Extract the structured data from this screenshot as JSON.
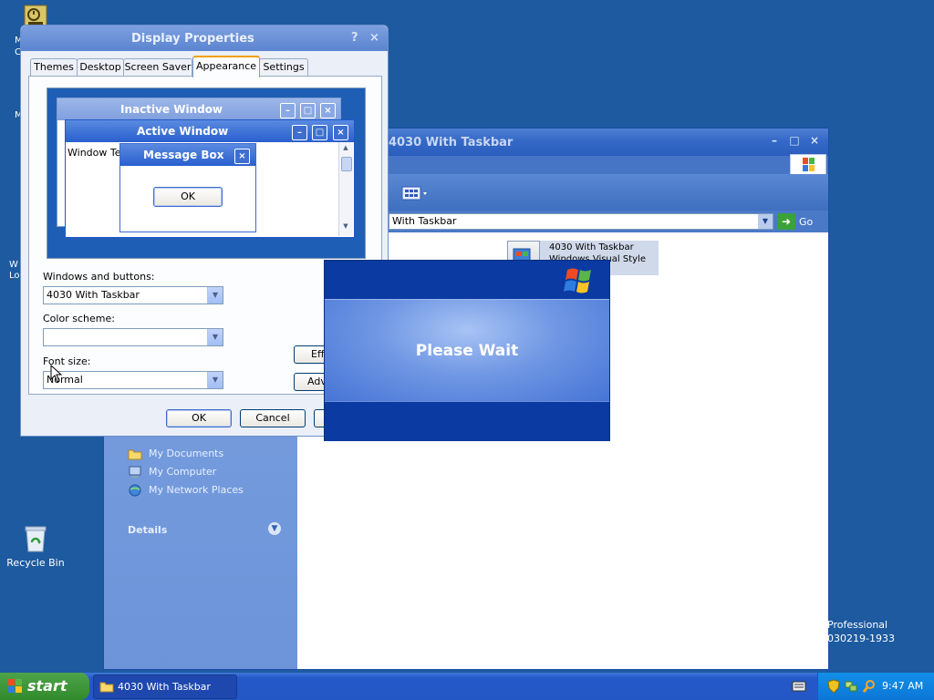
{
  "desktop": {
    "icons": [
      {
        "name": "M\nC",
        "partial": true
      },
      {
        "name": "M",
        "partial": true
      },
      {
        "name": "W\nLo",
        "partial": true
      },
      {
        "name": "Recycle Bin"
      }
    ]
  },
  "explorer": {
    "title": "4030 With Taskbar",
    "address_value": "With Taskbar",
    "go_label": "Go",
    "left_links": [
      "My Documents",
      "My Computer",
      "My Network Places"
    ],
    "details_label": "Details",
    "file": {
      "name": "4030 With Taskbar",
      "type": "Windows Visual Style File"
    }
  },
  "dialog": {
    "title": "Display Properties",
    "help": "?",
    "close": "×",
    "tabs": [
      "Themes",
      "Desktop",
      "Screen Saver",
      "Appearance",
      "Settings"
    ],
    "active_tab": "Appearance",
    "preview": {
      "inactive_title": "Inactive Window",
      "active_title": "Active Window",
      "window_text": "Window Text",
      "msgbox_title": "Message Box",
      "msgbox_ok": "OK"
    },
    "windows_buttons_label": "Windows and buttons:",
    "windows_buttons_value": "4030 With Taskbar",
    "color_scheme_label": "Color scheme:",
    "color_scheme_value": "",
    "font_size_label": "Font size:",
    "font_size_value": "Normal",
    "effects_label": "Eff",
    "advanced_label": "Adv",
    "ok_label": "OK",
    "cancel_label": "Cancel"
  },
  "splash": {
    "message": "Please Wait"
  },
  "watermark": {
    "line1": "Professional",
    "line2": "030219-1933"
  },
  "taskbar": {
    "start_label": "start",
    "task_item": "4030 With Taskbar",
    "clock": "9:47 AM"
  },
  "colors": {
    "desktop": "#1d5aa0",
    "title_active": "#5c85d0",
    "splash": "#0b3a9f",
    "taskbar": "#2459c8",
    "start": "#318a2c"
  }
}
